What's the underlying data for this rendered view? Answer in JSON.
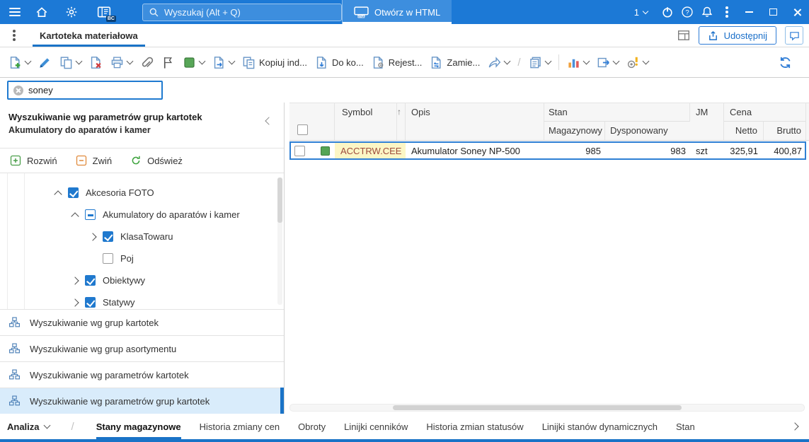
{
  "titlebar": {
    "search_placeholder": "Wyszukaj (Alt + Q)",
    "html_badge": "HTML",
    "open_html_label": "Otwórz w HTML",
    "counter": "1",
    "bc_badge": "BC"
  },
  "tabbar": {
    "active_tab": "Kartoteka materiałowa",
    "share_label": "Udostępnij"
  },
  "toolbar": {
    "kopiuj_label": "Kopiuj ind...",
    "doko_label": "Do ko...",
    "rejest_label": "Rejest...",
    "zamie_label": "Zamie..."
  },
  "filter": {
    "value": "soney"
  },
  "left_panel": {
    "title": "Wyszukiwanie wg parametrów grup kartotek",
    "subtitle": "Akumulatory do aparatów i kamer",
    "actions": {
      "rozwin": "Rozwiń",
      "zwin": "Zwiń",
      "odswiez": "Odśwież"
    },
    "tree": [
      {
        "label": "Akcesoria FOTO",
        "level": 0,
        "state": "checked",
        "expanded": true
      },
      {
        "label": "Akumulatory do aparatów i kamer",
        "level": 1,
        "state": "indeterminate",
        "expanded": true
      },
      {
        "label": "KlasaTowaru",
        "level": 2,
        "state": "checked",
        "expanded": false
      },
      {
        "label": "Poj",
        "level": 2,
        "state": "unchecked",
        "expanded": null
      },
      {
        "label": "Obiektywy",
        "level": 1,
        "state": "checked",
        "expanded": false
      },
      {
        "label": "Statywy",
        "level": 1,
        "state": "checked",
        "expanded": false
      }
    ],
    "modes": [
      {
        "label": "Wyszukiwanie wg grup kartotek",
        "selected": false
      },
      {
        "label": "Wyszukiwanie wg grup asortymentu",
        "selected": false
      },
      {
        "label": "Wyszukiwanie wg parametrów kartotek",
        "selected": false
      },
      {
        "label": "Wyszukiwanie wg parametrów grup kartotek",
        "selected": true
      }
    ]
  },
  "table": {
    "columns": {
      "symbol": "Symbol",
      "opis": "Opis",
      "stan": "Stan",
      "magazynowy": "Magazynowy",
      "dysponowany": "Dysponowany",
      "jm": "JM",
      "cena": "Cena",
      "netto": "Netto",
      "brutto": "Brutto"
    },
    "sort_indicator": "↑",
    "rows": [
      {
        "symbol": "ACCTRW.CEE",
        "opis": "Akumulator Soney NP-500",
        "magazynowy": "985",
        "dysponowany": "983",
        "jm": "szt",
        "netto": "325,91",
        "brutto": "400,87"
      }
    ]
  },
  "bottom": {
    "analiza_label": "Analiza",
    "tabs": [
      {
        "label": "Stany magazynowe",
        "active": true
      },
      {
        "label": "Historia zmiany cen",
        "active": false
      },
      {
        "label": "Obroty",
        "active": false
      },
      {
        "label": "Linijki cenników",
        "active": false
      },
      {
        "label": "Historia zmian statusów",
        "active": false
      },
      {
        "label": "Linijki stanów dynamicznych",
        "active": false
      },
      {
        "label": "Stan",
        "active": false
      }
    ]
  },
  "colors": {
    "titlebar": "#1c79d6",
    "accent": "#1a73c7",
    "selected_row_border": "#2f80d4",
    "match_highlight_bg": "#fcf6c5",
    "match_highlight_text": "#9e4b3c",
    "selected_mode_bg": "#d9ecfb",
    "row_color_chip": "#55a555"
  }
}
